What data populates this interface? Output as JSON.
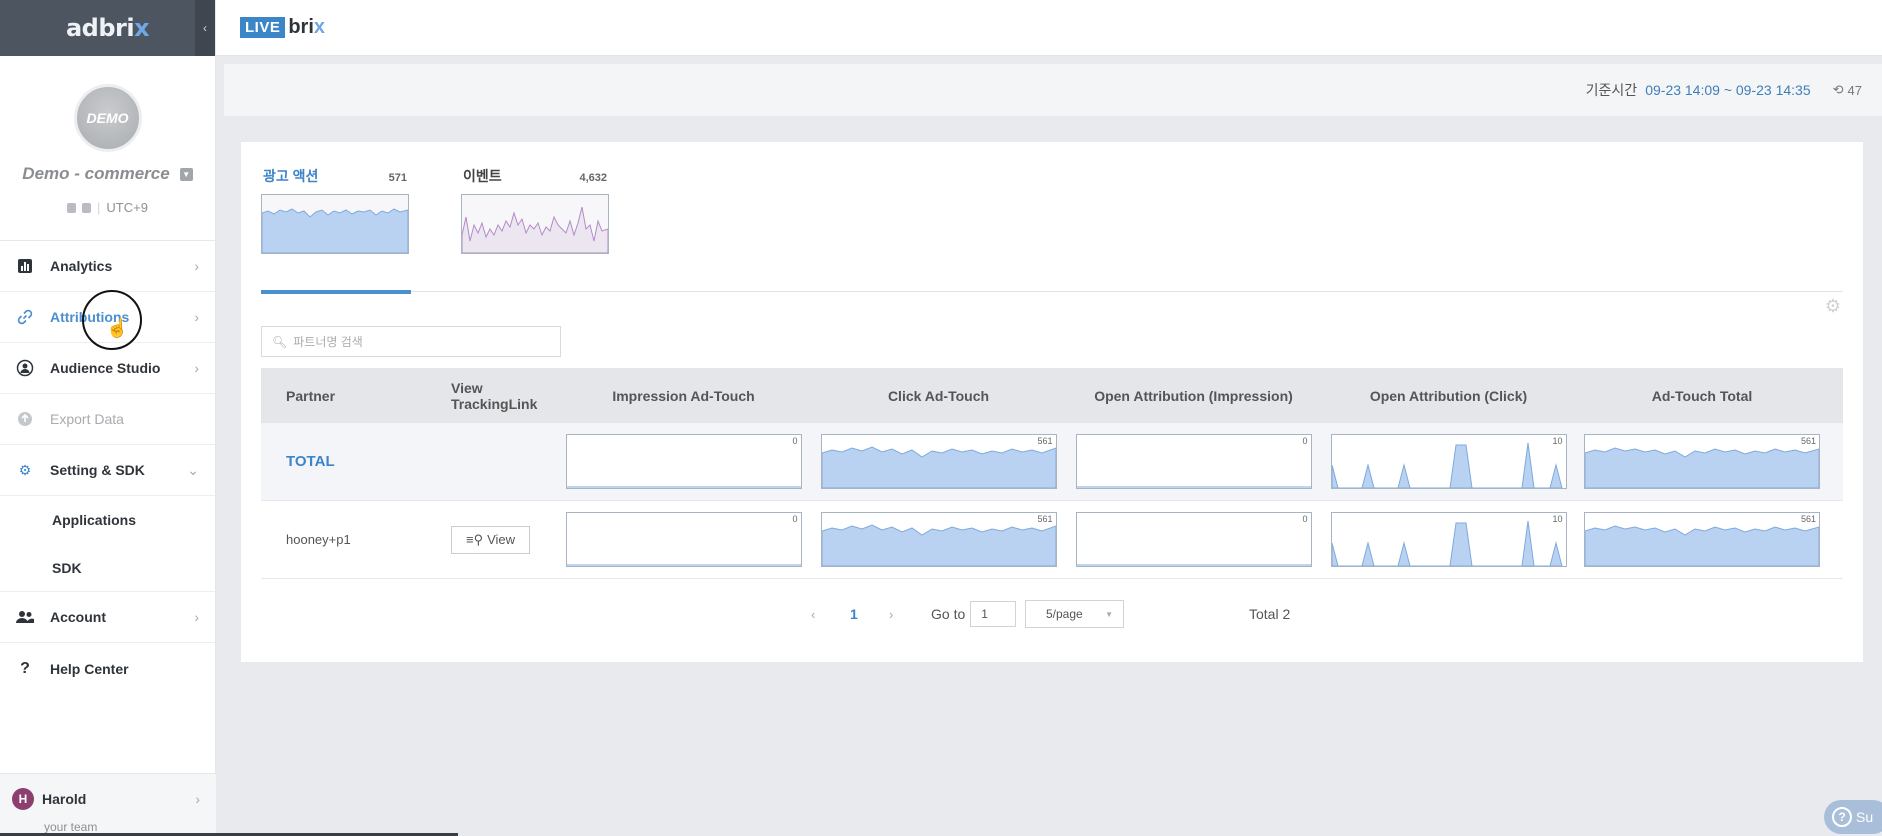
{
  "brand": {
    "logo_main": "adbri",
    "logo_x": "x",
    "collapse_glyph": "‹"
  },
  "profile": {
    "avatar_text": "DEMO",
    "app_name": "Demo - commerce",
    "timezone": "UTC+9"
  },
  "nav": {
    "analytics": "Analytics",
    "attributions": "Attributions",
    "audience_studio": "Audience Studio",
    "export_data": "Export Data",
    "setting_sdk": "Setting & SDK",
    "applications": "Applications",
    "sdk": "SDK",
    "account": "Account",
    "help_center": "Help Center"
  },
  "user": {
    "initial": "H",
    "name": "Harold",
    "team": "your team"
  },
  "header": {
    "live_box": "LIVE",
    "brix": "bri",
    "brix_x": "x"
  },
  "timebar": {
    "label": "기준시간",
    "range": "09-23 14:09 ~ 09-23 14:35",
    "refresh_count": "47"
  },
  "tabs": [
    {
      "title": "광고 액션",
      "count": "571"
    },
    {
      "title": "이벤트",
      "count": "4,632"
    }
  ],
  "search": {
    "placeholder": "파트너명 검색"
  },
  "table": {
    "headers": {
      "partner": "Partner",
      "view_tracking": "View TrackingLink",
      "impression": "Impression Ad-Touch",
      "click": "Click Ad-Touch",
      "open_impression": "Open Attribution (Impression)",
      "open_click": "Open Attribution (Click)",
      "total": "Ad-Touch Total"
    },
    "rows": [
      {
        "partner": "TOTAL",
        "view": "",
        "impression": "0",
        "click": "561",
        "open_impression": "0",
        "open_click": "10",
        "total": "561"
      },
      {
        "partner": "hooney+p1",
        "view": "View",
        "impression": "0",
        "click": "561",
        "open_impression": "0",
        "open_click": "10",
        "total": "561"
      }
    ]
  },
  "pager": {
    "prev": "‹",
    "current": "1",
    "next": "›",
    "goto_label": "Go to",
    "goto_value": "1",
    "page_size": "5/page",
    "total": "Total 2"
  },
  "support": {
    "label": "Su"
  },
  "colors": {
    "accent": "#3d84c9",
    "area_fill": "#b9d2f2",
    "area_line": "#7fa9de",
    "event_line": "#b58bc6"
  }
}
